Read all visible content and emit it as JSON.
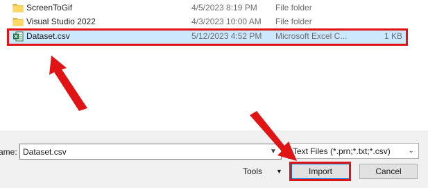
{
  "files": [
    {
      "name": "ScreenToGif",
      "date": "4/5/2023 8:19 PM",
      "type": "File folder",
      "size": "",
      "icon": "folder-icon",
      "selected": false
    },
    {
      "name": "Visual Studio 2022",
      "date": "4/3/2023 10:00 AM",
      "type": "File folder",
      "size": "",
      "icon": "folder-icon",
      "selected": false
    },
    {
      "name": "Dataset.csv",
      "date": "5/12/2023 4:52 PM",
      "type": "Microsoft Excel C...",
      "size": "1 KB",
      "icon": "excel-csv-icon",
      "selected": true
    }
  ],
  "footer": {
    "name_label": "ame:",
    "file_name_value": "Dataset.csv",
    "file_type_filter": "Text Files (*.prn;*.txt;*.csv)",
    "tools_label": "Tools",
    "import_label": "Import",
    "cancel_label": "Cancel"
  },
  "colors": {
    "annotation_red": "#e01414",
    "selection_bg": "#cce8ff",
    "folder_yellow": "#f2c94c",
    "excel_green": "#1d6f42"
  }
}
